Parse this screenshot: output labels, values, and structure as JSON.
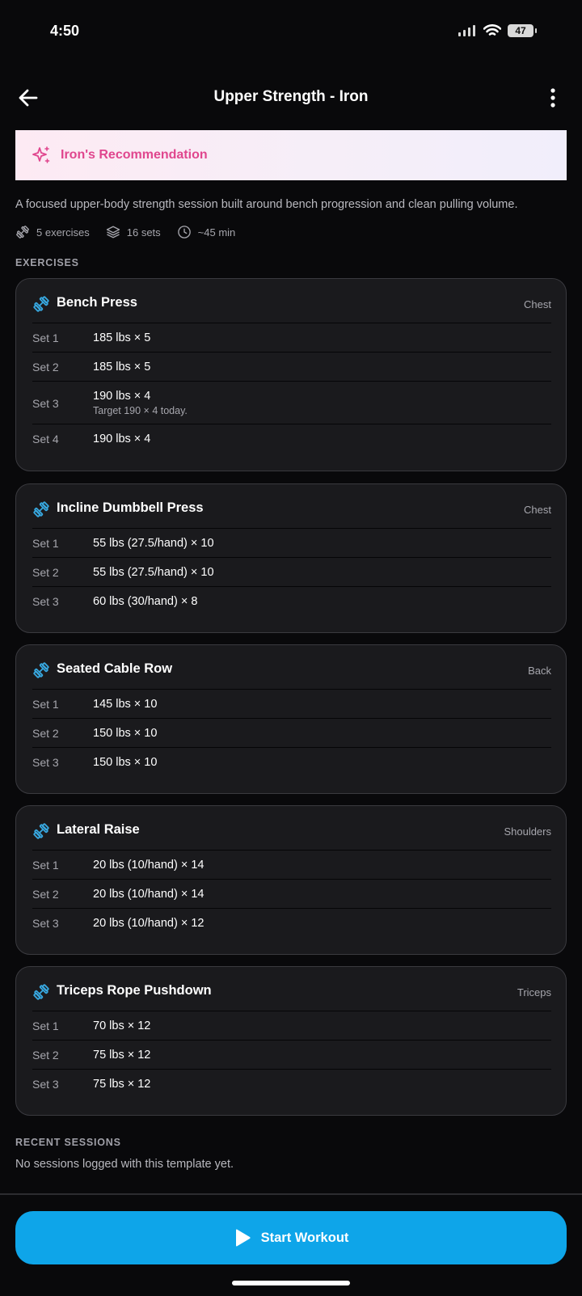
{
  "status_bar": {
    "time": "4:50",
    "battery": "47"
  },
  "header": {
    "title": "Upper Strength - Iron"
  },
  "recommendation": {
    "label": "Iron's Recommendation"
  },
  "description": "A focused upper-body strength session built around bench progression and clean pulling volume.",
  "meta": {
    "exercises": "5 exercises",
    "sets": "16 sets",
    "duration": "~45 min"
  },
  "sections": {
    "exercises": "EXERCISES",
    "recent": "RECENT SESSIONS"
  },
  "exercises": [
    {
      "name": "Bench Press",
      "group": "Chest",
      "sets": [
        {
          "label": "Set 1",
          "value": "185 lbs × 5"
        },
        {
          "label": "Set 2",
          "value": "185 lbs × 5"
        },
        {
          "label": "Set 3",
          "value": "190 lbs × 4",
          "note": "Target 190 × 4 today."
        },
        {
          "label": "Set 4",
          "value": "190 lbs × 4"
        }
      ]
    },
    {
      "name": "Incline Dumbbell Press",
      "group": "Chest",
      "sets": [
        {
          "label": "Set 1",
          "value": "55 lbs (27.5/hand) × 10"
        },
        {
          "label": "Set 2",
          "value": "55 lbs (27.5/hand) × 10"
        },
        {
          "label": "Set 3",
          "value": "60 lbs (30/hand) × 8"
        }
      ]
    },
    {
      "name": "Seated Cable Row",
      "group": "Back",
      "sets": [
        {
          "label": "Set 1",
          "value": "145 lbs × 10"
        },
        {
          "label": "Set 2",
          "value": "150 lbs × 10"
        },
        {
          "label": "Set 3",
          "value": "150 lbs × 10"
        }
      ]
    },
    {
      "name": "Lateral Raise",
      "group": "Shoulders",
      "sets": [
        {
          "label": "Set 1",
          "value": "20 lbs (10/hand) × 14"
        },
        {
          "label": "Set 2",
          "value": "20 lbs (10/hand) × 14"
        },
        {
          "label": "Set 3",
          "value": "20 lbs (10/hand) × 12"
        }
      ]
    },
    {
      "name": "Triceps Rope Pushdown",
      "group": "Triceps",
      "sets": [
        {
          "label": "Set 1",
          "value": "70 lbs × 12"
        },
        {
          "label": "Set 2",
          "value": "75 lbs × 12"
        },
        {
          "label": "Set 3",
          "value": "75 lbs × 12"
        }
      ]
    }
  ],
  "recent_sessions": {
    "empty_text": "No sessions logged with this template yet."
  },
  "actions": {
    "start_workout": "Start Workout"
  },
  "colors": {
    "accent": "#0ea5e9",
    "recommendation_text": "#e0468e",
    "icon_blue": "#38a8e0"
  },
  "icons": [
    "back-arrow-icon",
    "more-vertical-icon",
    "sparkle-icon",
    "dumbbell-icon",
    "layers-icon",
    "clock-icon",
    "play-icon",
    "wifi-icon",
    "signal-icon",
    "battery-icon"
  ]
}
